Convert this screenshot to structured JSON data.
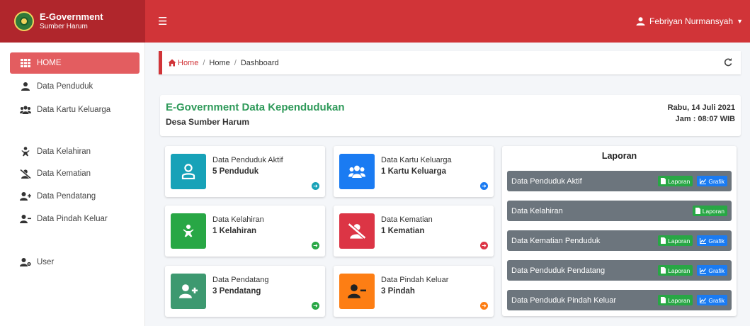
{
  "brand": {
    "title": "E-Government",
    "subtitle": "Sumber Harum"
  },
  "user": {
    "name": "Febriyan Nurmansyah"
  },
  "sidebar": {
    "items": [
      {
        "label": "HOME",
        "icon": "grid-icon"
      },
      {
        "label": "Data Penduduk",
        "icon": "user-icon"
      },
      {
        "label": "Data Kartu Keluarga",
        "icon": "users-icon"
      },
      {
        "label": "Data Kelahiran",
        "icon": "baby-icon"
      },
      {
        "label": "Data Kematian",
        "icon": "user-slash-icon"
      },
      {
        "label": "Data Pendatang",
        "icon": "user-plus-icon"
      },
      {
        "label": "Data Pindah Keluar",
        "icon": "user-minus-icon"
      },
      {
        "label": "User",
        "icon": "user-cog-icon"
      }
    ]
  },
  "breadcrumb": {
    "home": "Home",
    "level1": "Home",
    "level2": "Dashboard"
  },
  "header": {
    "title": "E-Government Data Kependudukan",
    "subtitle": "Desa Sumber Harum",
    "date": "Rabu, 14 Juli 2021",
    "time": "Jam : 08:07 WIB"
  },
  "stats": [
    {
      "label": "Data Penduduk Aktif",
      "value": "5 Penduduk",
      "color": "#17a2b8",
      "arrow": "#17a2b8"
    },
    {
      "label": "Data Kartu Keluarga",
      "value": "1 Kartu Keluarga",
      "color": "#1a7bf2",
      "arrow": "#1a7bf2"
    },
    {
      "label": "Data Kelahiran",
      "value": "1 Kelahiran",
      "color": "#28a745",
      "arrow": "#28a745"
    },
    {
      "label": "Data Kematian",
      "value": "1 Kematian",
      "color": "#dc3545",
      "arrow": "#dc3545"
    },
    {
      "label": "Data Pendatang",
      "value": "3 Pendatang",
      "color": "#3d9970",
      "arrow": "#28a745"
    },
    {
      "label": "Data Pindah Keluar",
      "value": "3 Pindah",
      "color": "#fd7e14",
      "arrow": "#fd7e14"
    }
  ],
  "report": {
    "title": "Laporan",
    "btn_laporan": "Laporan",
    "btn_grafik": "Grafik",
    "rows": [
      {
        "label": "Data Penduduk Aktif"
      },
      {
        "label": "Data Kelahiran"
      },
      {
        "label": "Data Kematian Penduduk"
      },
      {
        "label": "Data Penduduk Pendatang"
      },
      {
        "label": "Data Penduduk Pindah Keluar"
      }
    ]
  },
  "colors": {
    "brand": "#b0262c",
    "navbar": "#d13438",
    "accent_green": "#2f9a5a",
    "report_row": "#6c757d"
  }
}
